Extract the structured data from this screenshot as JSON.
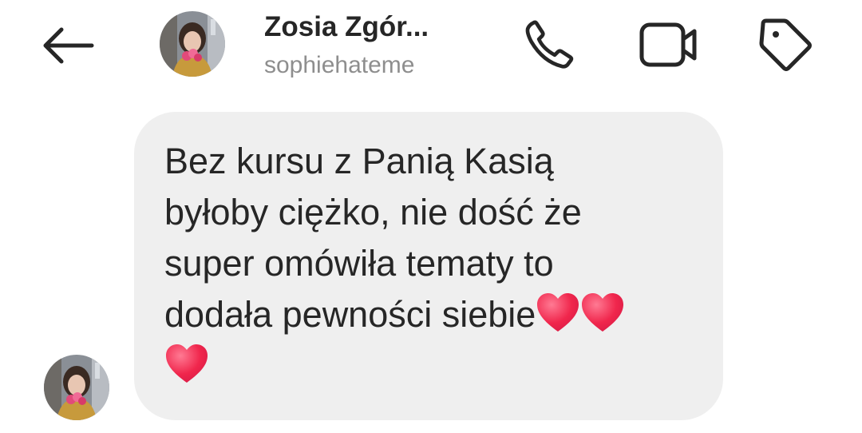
{
  "header": {
    "name": "Zosia Zgór...",
    "username": "sophiehateme",
    "back_icon": "arrow-left-icon",
    "call_icon": "phone-icon",
    "video_icon": "video-camera-icon",
    "tag_icon": "tag-icon"
  },
  "message": {
    "lines": [
      "Bez kursu z Panią Kasią",
      "byłoby ciężko, nie dość że",
      "super omówiła tematy to",
      "dodała pewności siebie"
    ],
    "emoji": "heart-emoji",
    "emoji_count": 3
  },
  "colors": {
    "bubble_bg": "#efefef",
    "text": "#262626",
    "secondary_text": "#8e8e8e",
    "heart": "#f0264c"
  }
}
